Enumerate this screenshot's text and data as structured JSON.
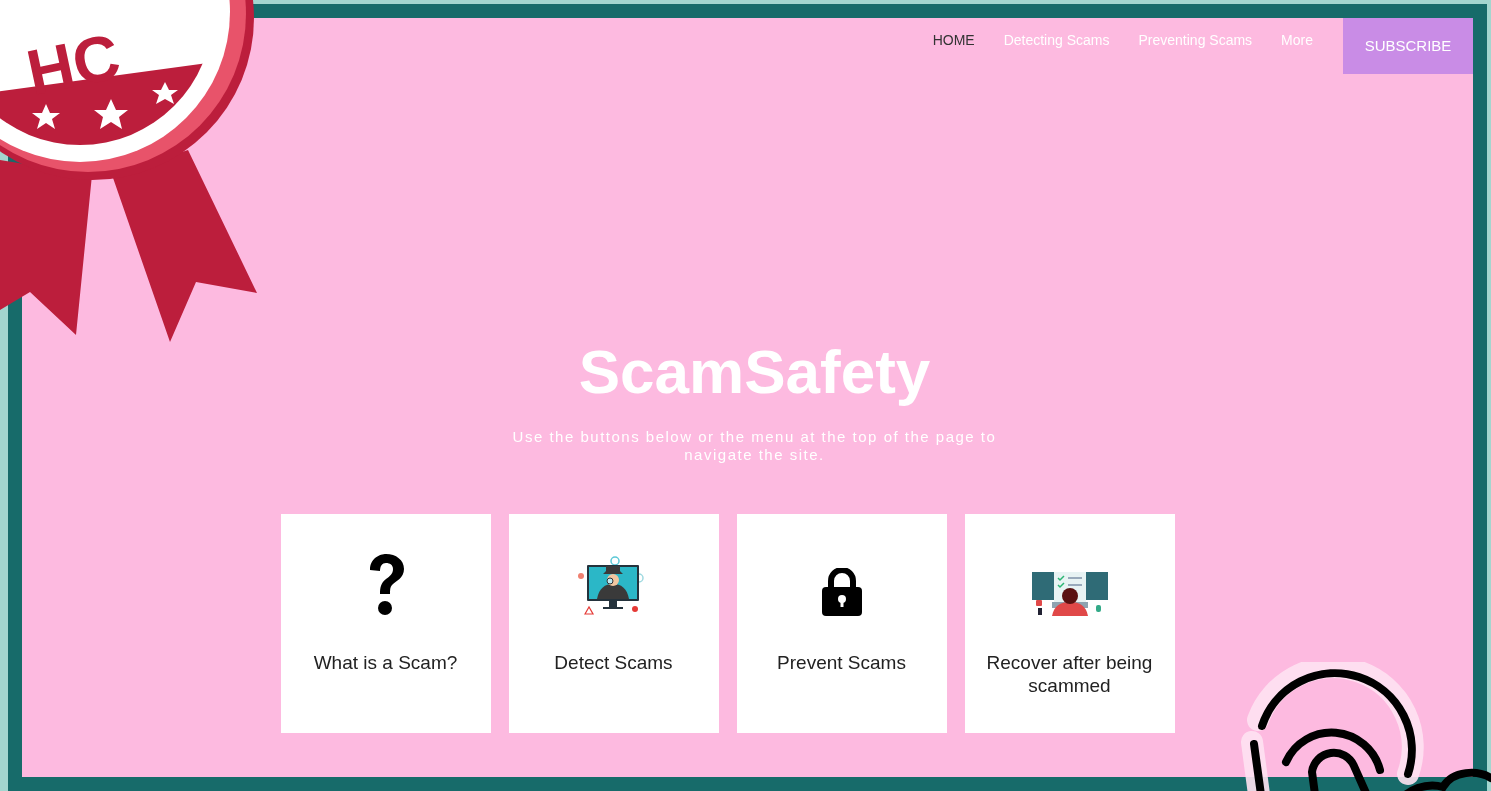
{
  "nav": {
    "items": [
      {
        "label": "HOME",
        "selected": true
      },
      {
        "label": "Detecting Scams",
        "selected": false
      },
      {
        "label": "Preventing Scams",
        "selected": false
      },
      {
        "label": "More",
        "selected": false
      }
    ],
    "subscribe": "SUBSCRIBE"
  },
  "hero": {
    "title": "ScamSafety",
    "subtitle": "Use the buttons below or the menu at the top of the page to navigate the site."
  },
  "cards": [
    {
      "kind": "question",
      "label": "What is a Scam?"
    },
    {
      "kind": "spy",
      "label": "Detect Scams"
    },
    {
      "kind": "lock",
      "label": "Prevent Scams"
    },
    {
      "kind": "desk",
      "label": "Recover after being scammed"
    }
  ],
  "badge": {
    "text": "HC"
  }
}
